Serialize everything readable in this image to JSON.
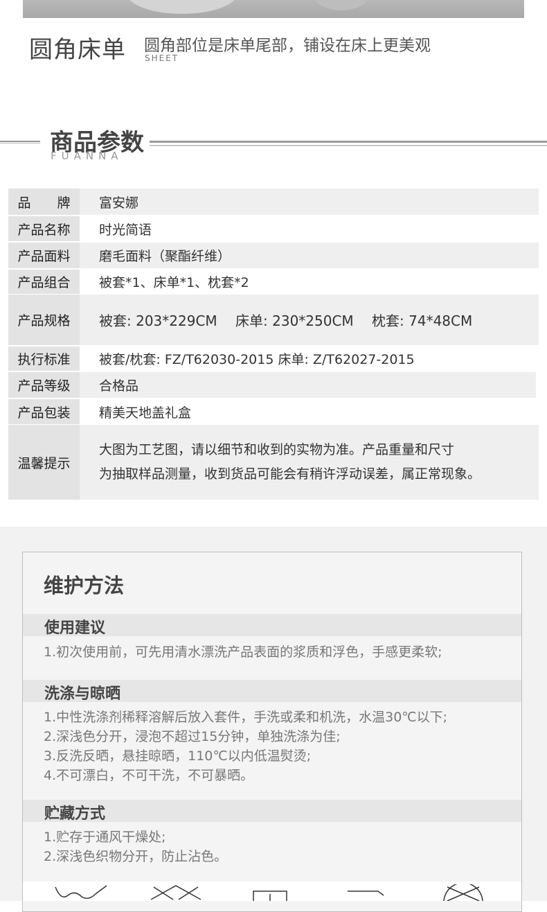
{
  "corner_sheet": {
    "title": "圆角床单",
    "description": "圆角部位是床单尾部，铺设在床上更美观",
    "subtitle": "SHEET"
  },
  "params_section": {
    "title": "商品参数",
    "subtitle": "FUANNA"
  },
  "params": [
    {
      "label": "品　　牌",
      "value": "富安娜"
    },
    {
      "label": "产品名称",
      "value": "时光简语"
    },
    {
      "label": "产品面料",
      "value": "磨毛面料（聚酯纤维）"
    },
    {
      "label": "产品组合",
      "value": "被套*1、床单*1、枕套*2"
    },
    {
      "label": "产品规格",
      "value": "被套: 203*229CM　 床单: 230*250CM　 枕套: 74*48CM"
    },
    {
      "label": "执行标准",
      "value": "被套/枕套:  FZ/T62030-2015   床单: Z/T62027-2015"
    },
    {
      "label": "产品等级",
      "value": "合格品"
    },
    {
      "label": "产品包装",
      "value": "精美天地盖礼盒"
    },
    {
      "label": "温馨提示",
      "lines": [
        "大图为工艺图，请以细节和收到的实物为准。产品重量和尺寸",
        "为抽取样品测量，收到货品可能会有稍许浮动误差，属正常现象。"
      ]
    }
  ],
  "care": {
    "title": "维护方法",
    "usage": {
      "heading": "使用建议",
      "lines": [
        "1.初次使用前，可先用清水漂洗产品表面的浆质和浮色，手感更柔软;"
      ]
    },
    "washing": {
      "heading": "洗涤与晾晒",
      "lines": [
        "1.中性洗涤剂稀释溶解后放入套件，手洗或柔和机洗，水温30℃以下;",
        "2.深浅色分开，浸泡不超过15分钟，单独洗涤为佳;",
        "3.反洗反晒，悬挂晾晒，110℃以内低温熨烫;",
        "4.不可漂白，不可干洗，不可暴晒。"
      ]
    },
    "storage": {
      "heading": "贮藏方式",
      "lines": [
        "1.贮存于通风干燥处;",
        "2.深浅色织物分开，防止沾色。"
      ]
    },
    "care_icons": [
      "hand-wash-icon",
      "no-bleach-icon",
      "tumble-dry-icon",
      "line-dry-icon",
      "no-dry-clean-icon"
    ]
  }
}
